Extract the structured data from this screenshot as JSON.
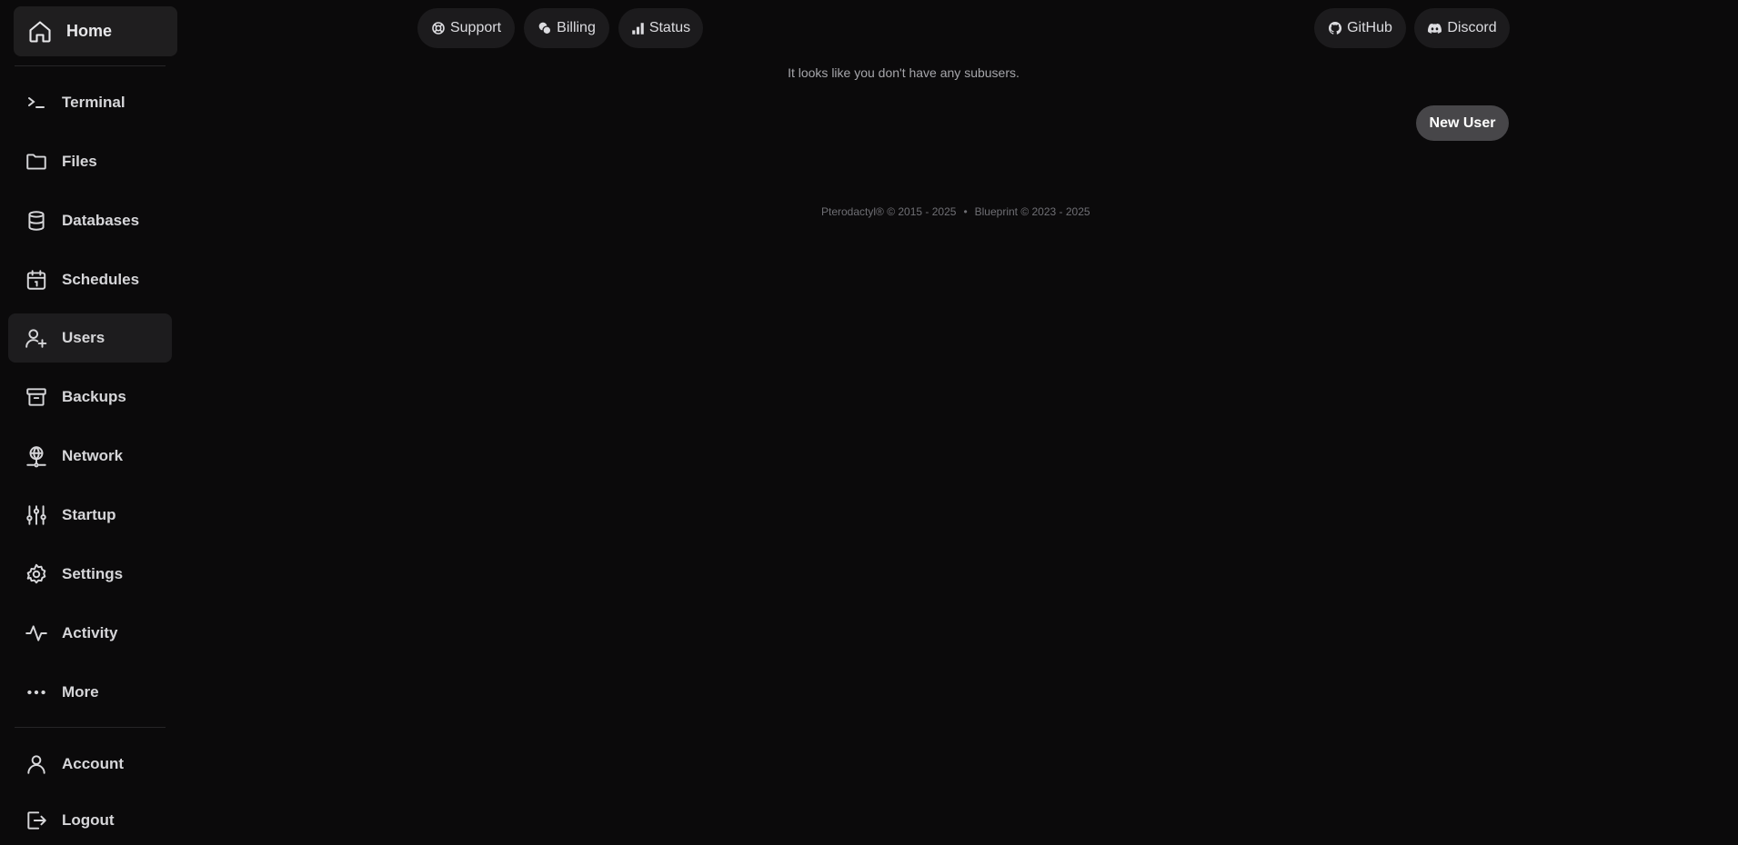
{
  "sidebar": {
    "home_label": "Home",
    "items": [
      {
        "label": "Terminal",
        "icon": "terminal-icon"
      },
      {
        "label": "Files",
        "icon": "folder-icon"
      },
      {
        "label": "Databases",
        "icon": "database-icon"
      },
      {
        "label": "Schedules",
        "icon": "calendar-icon"
      },
      {
        "label": "Users",
        "icon": "users-icon",
        "active": true
      },
      {
        "label": "Backups",
        "icon": "archive-icon"
      },
      {
        "label": "Network",
        "icon": "network-icon"
      },
      {
        "label": "Startup",
        "icon": "sliders-icon"
      },
      {
        "label": "Settings",
        "icon": "gear-icon"
      },
      {
        "label": "Activity",
        "icon": "activity-icon"
      },
      {
        "label": "More",
        "icon": "ellipsis-icon"
      }
    ],
    "account_label": "Account",
    "logout_label": "Logout"
  },
  "topbar": {
    "support_label": "Support",
    "billing_label": "Billing",
    "status_label": "Status",
    "github_label": "GitHub",
    "discord_label": "Discord"
  },
  "main": {
    "empty_message": "It looks like you don't have any subusers.",
    "new_user_label": "New User"
  },
  "footer": {
    "pterodactyl": "Pterodactyl® © 2015 - 2025",
    "separator": "•",
    "blueprint": "Blueprint © 2023 - 2025"
  },
  "colors": {
    "background": "#0b0a0b",
    "pill": "#1c1b1d",
    "active_item": "#1d1c1e",
    "button": "#474649"
  }
}
